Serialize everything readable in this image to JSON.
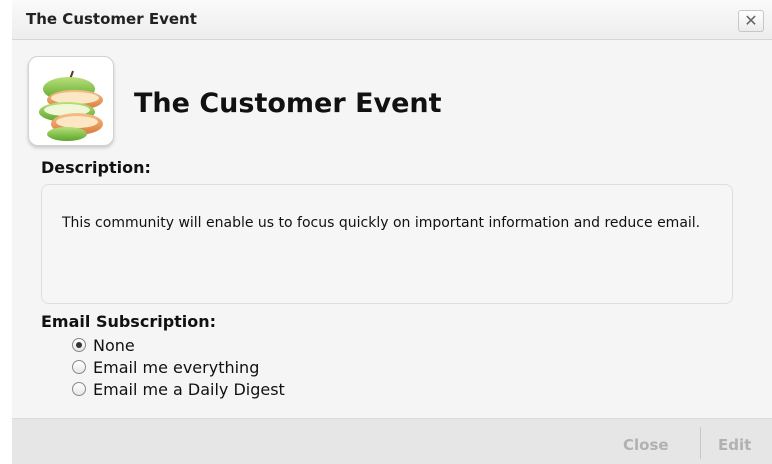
{
  "dialog": {
    "title": "The Customer Event",
    "close_glyph": "✕"
  },
  "community": {
    "name": "The Customer Event",
    "logo_icon": "sliced-apple-icon"
  },
  "description": {
    "label": "Description:",
    "text": "This community will enable us to focus quickly on important information and reduce email."
  },
  "email_subscription": {
    "label": "Email Subscription:",
    "selected": "None",
    "options": [
      {
        "label": "None",
        "checked": true
      },
      {
        "label": "Email me everything",
        "checked": false
      },
      {
        "label": "Email me a Daily Digest",
        "checked": false
      }
    ]
  },
  "footer": {
    "close_label": "Close",
    "edit_label": "Edit"
  }
}
